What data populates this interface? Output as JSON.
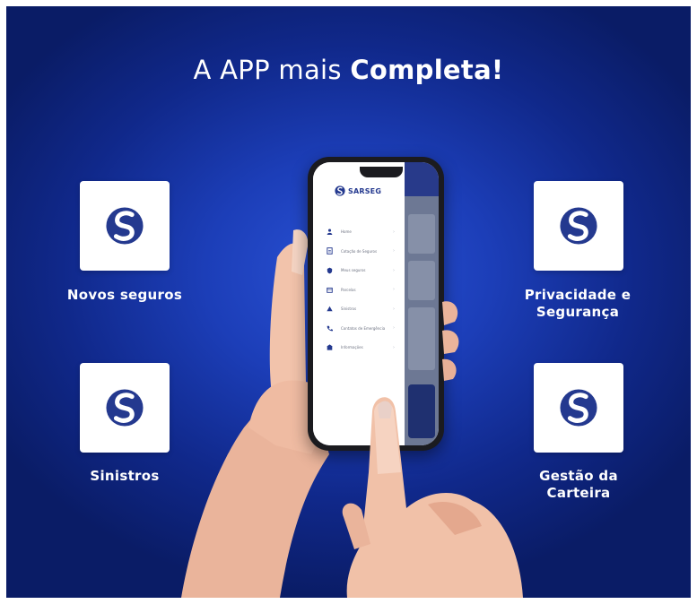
{
  "headline": {
    "regular": "A APP mais ",
    "bold": "Completa!"
  },
  "features": [
    {
      "label": "Novos seguros"
    },
    {
      "label": "Privacidade e Segurança"
    },
    {
      "label": "Sinistros"
    },
    {
      "label": "Gestão da Carteira"
    }
  ],
  "app": {
    "brand": "SARSEG",
    "menu": [
      {
        "label": "Home",
        "icon": "user-icon"
      },
      {
        "label": "Cotação de Seguros",
        "icon": "document-icon"
      },
      {
        "label": "Meus seguros",
        "icon": "shield-icon"
      },
      {
        "label": "Parcelas",
        "icon": "calendar-icon"
      },
      {
        "label": "Sinistros",
        "icon": "alert-icon"
      },
      {
        "label": "Contatos de Emergência",
        "icon": "phone-icon"
      },
      {
        "label": "Informações",
        "icon": "building-icon"
      }
    ]
  },
  "colors": {
    "background": "#1c3eb8",
    "brand": "#24398f",
    "card": "#ffffff"
  }
}
